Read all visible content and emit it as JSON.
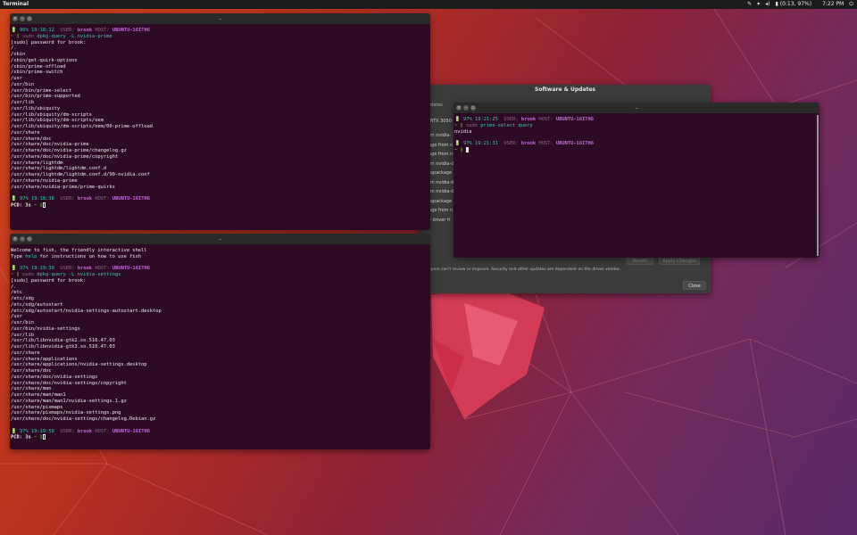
{
  "topbar": {
    "app_name": "Terminal",
    "battery": "(0:13, 97%)",
    "clock": "7:22 PM"
  },
  "windows": {
    "term1": {
      "title": "–",
      "lines": [
        [
          {
            "t": "🔋 96% ",
            "c": "c-teal"
          },
          {
            "t": "19:18:12",
            "c": "c-teal"
          },
          {
            "t": "  USER: ",
            "c": "c-gray"
          },
          {
            "t": "brook",
            "c": "c-purple"
          },
          {
            "t": " HOST: ",
            "c": "c-gray"
          },
          {
            "t": "UBUNTU-16ITH6",
            "c": "c-purple"
          }
        ],
        [
          {
            "t": "~ ",
            "c": "c-green"
          },
          {
            "t": "⟫ ",
            "c": "c-green"
          },
          {
            "t": "sudo ",
            "c": "c-cmd"
          },
          {
            "t": "dpkg-query -L nvidia-prime",
            "c": "c-teal"
          }
        ],
        [
          {
            "t": "[sudo] password for brook:"
          }
        ],
        [
          {
            "t": "/."
          }
        ],
        [
          {
            "t": "/sbin"
          }
        ],
        [
          {
            "t": "/sbin/get-quirk-options"
          }
        ],
        [
          {
            "t": "/sbin/prime-offload"
          }
        ],
        [
          {
            "t": "/sbin/prime-switch"
          }
        ],
        [
          {
            "t": "/usr"
          }
        ],
        [
          {
            "t": "/usr/bin"
          }
        ],
        [
          {
            "t": "/usr/bin/prime-select"
          }
        ],
        [
          {
            "t": "/usr/bin/prime-supported"
          }
        ],
        [
          {
            "t": "/usr/lib"
          }
        ],
        [
          {
            "t": "/usr/lib/ubiquity"
          }
        ],
        [
          {
            "t": "/usr/lib/ubiquity/dm-scripts"
          }
        ],
        [
          {
            "t": "/usr/lib/ubiquity/dm-scripts/oem"
          }
        ],
        [
          {
            "t": "/usr/lib/ubiquity/dm-scripts/oem/00-prime-offload"
          }
        ],
        [
          {
            "t": "/usr/share"
          }
        ],
        [
          {
            "t": "/usr/share/doc"
          }
        ],
        [
          {
            "t": "/usr/share/doc/nvidia-prime"
          }
        ],
        [
          {
            "t": "/usr/share/doc/nvidia-prime/changelog.gz"
          }
        ],
        [
          {
            "t": "/usr/share/doc/nvidia-prime/copyright"
          }
        ],
        [
          {
            "t": "/usr/share/lightdm"
          }
        ],
        [
          {
            "t": "/usr/share/lightdm/lightdm.conf.d"
          }
        ],
        [
          {
            "t": "/usr/share/lightdm/lightdm.conf.d/90-nvidia.conf"
          }
        ],
        [
          {
            "t": "/usr/share/nvidia-prime"
          }
        ],
        [
          {
            "t": "/usr/share/nvidia-prime/prime-quirks"
          }
        ],
        [
          {
            "t": ""
          }
        ],
        [
          {
            "t": "🔋 97% ",
            "c": "c-teal"
          },
          {
            "t": "19:18:38",
            "c": "c-teal"
          },
          {
            "t": "  USER: ",
            "c": "c-gray"
          },
          {
            "t": "brook",
            "c": "c-purple"
          },
          {
            "t": " HOST: ",
            "c": "c-gray"
          },
          {
            "t": "UBUNTU-16ITH6",
            "c": "c-purple"
          }
        ],
        [
          {
            "t": "PCD: 3s ",
            "c": "c-bold"
          },
          {
            "t": "~ ",
            "c": "c-green"
          },
          {
            "t": "⟫",
            "c": "c-green"
          },
          {
            "cursor": "hollow"
          }
        ]
      ]
    },
    "term2": {
      "title": "–",
      "lines": [
        [
          {
            "t": "Welcome to fish, the friendly interactive shell"
          }
        ],
        [
          {
            "t": "Type "
          },
          {
            "t": "help",
            "c": "c-teal"
          },
          {
            "t": " for instructions on how to use fish"
          }
        ],
        [
          {
            "t": ""
          }
        ],
        [
          {
            "t": "🔋 97% ",
            "c": "c-teal"
          },
          {
            "t": "19:19:30",
            "c": "c-teal"
          },
          {
            "t": "  USER: ",
            "c": "c-gray"
          },
          {
            "t": "brook",
            "c": "c-purple"
          },
          {
            "t": " HOST: ",
            "c": "c-gray"
          },
          {
            "t": "UBUNTU-16ITH6",
            "c": "c-purple"
          }
        ],
        [
          {
            "t": "~ ",
            "c": "c-green"
          },
          {
            "t": "⟫ ",
            "c": "c-green"
          },
          {
            "t": "sudo ",
            "c": "c-cmd"
          },
          {
            "t": "dpkg-query -L nvidia-settings",
            "c": "c-teal"
          }
        ],
        [
          {
            "t": "[sudo] password for brook:"
          }
        ],
        [
          {
            "t": "/."
          }
        ],
        [
          {
            "t": "/etc"
          }
        ],
        [
          {
            "t": "/etc/xdg"
          }
        ],
        [
          {
            "t": "/etc/xdg/autostart"
          }
        ],
        [
          {
            "t": "/etc/xdg/autostart/nvidia-settings-autostart.desktop"
          }
        ],
        [
          {
            "t": "/usr"
          }
        ],
        [
          {
            "t": "/usr/bin"
          }
        ],
        [
          {
            "t": "/usr/bin/nvidia-settings"
          }
        ],
        [
          {
            "t": "/usr/lib"
          }
        ],
        [
          {
            "t": "/usr/lib/libnvidia-gtk2.so.510.47.03"
          }
        ],
        [
          {
            "t": "/usr/lib/libnvidia-gtk3.so.510.47.03"
          }
        ],
        [
          {
            "t": "/usr/share"
          }
        ],
        [
          {
            "t": "/usr/share/applications"
          }
        ],
        [
          {
            "t": "/usr/share/applications/nvidia-settings.desktop"
          }
        ],
        [
          {
            "t": "/usr/share/doc"
          }
        ],
        [
          {
            "t": "/usr/share/doc/nvidia-settings"
          }
        ],
        [
          {
            "t": "/usr/share/doc/nvidia-settings/copyright"
          }
        ],
        [
          {
            "t": "/usr/share/man"
          }
        ],
        [
          {
            "t": "/usr/share/man/man1"
          }
        ],
        [
          {
            "t": "/usr/share/man/man1/nvidia-settings.1.gz"
          }
        ],
        [
          {
            "t": "/usr/share/pixmaps"
          }
        ],
        [
          {
            "t": "/usr/share/pixmaps/nvidia-settings.png"
          }
        ],
        [
          {
            "t": "/usr/share/doc/nvidia-settings/changelog.Debian.gz"
          }
        ],
        [
          {
            "t": ""
          }
        ],
        [
          {
            "t": "🔋 97% ",
            "c": "c-teal"
          },
          {
            "t": "19:19:58",
            "c": "c-teal"
          },
          {
            "t": "  USER: ",
            "c": "c-gray"
          },
          {
            "t": "brook",
            "c": "c-purple"
          },
          {
            "t": " HOST: ",
            "c": "c-gray"
          },
          {
            "t": "UBUNTU-16ITH6",
            "c": "c-purple"
          }
        ],
        [
          {
            "t": "PCD: 3s ",
            "c": "c-bold"
          },
          {
            "t": "~ ",
            "c": "c-green"
          },
          {
            "t": "⟫",
            "c": "c-green"
          },
          {
            "cursor": "hollow"
          }
        ]
      ]
    },
    "term3": {
      "title": "–",
      "lines": [
        [
          {
            "t": "🔋 97% ",
            "c": "c-teal"
          },
          {
            "t": "19:21:25",
            "c": "c-teal"
          },
          {
            "t": "  USER: ",
            "c": "c-gray"
          },
          {
            "t": "brook",
            "c": "c-purple"
          },
          {
            "t": " HOST: ",
            "c": "c-gray"
          },
          {
            "t": "UBUNTU-16ITH6",
            "c": "c-purple"
          }
        ],
        [
          {
            "t": "~ ",
            "c": "c-green"
          },
          {
            "t": "⟫ ",
            "c": "c-green"
          },
          {
            "t": "sudo ",
            "c": "c-cmd"
          },
          {
            "t": "prime-select query",
            "c": "c-teal"
          }
        ],
        [
          {
            "t": "nvidia"
          }
        ],
        [
          {
            "t": ""
          }
        ],
        [
          {
            "t": "🔋 97% ",
            "c": "c-teal"
          },
          {
            "t": "19:21:31",
            "c": "c-teal"
          },
          {
            "t": "  USER: ",
            "c": "c-gray"
          },
          {
            "t": "brook",
            "c": "c-purple"
          },
          {
            "t": " HOST: ",
            "c": "c-gray"
          },
          {
            "t": "UBUNTU-16ITH6",
            "c": "c-purple"
          }
        ],
        [
          {
            "t": "~ ",
            "c": "c-green"
          },
          {
            "t": "⟫ ",
            "c": "c-green"
          },
          {
            "cursor": "solid"
          }
        ]
      ]
    }
  },
  "dialog": {
    "title": "Software & Updates",
    "tab_fragment": "dates",
    "device_fragment": "RTX 3050",
    "list_items": [
      "-m nvidia-",
      "age from n",
      "age from n",
      "-m nvidia-d",
      "tapackage",
      "-m nvidia-d",
      "-m nvidia-d",
      "tapackage",
      "age from n",
      "y driver fr"
    ],
    "note": "opers can't review or improve. Security and other updates are dependent on the driver vendor.",
    "revert_label": "Revert",
    "apply_label": "Apply Changes",
    "close_label": "Close"
  }
}
